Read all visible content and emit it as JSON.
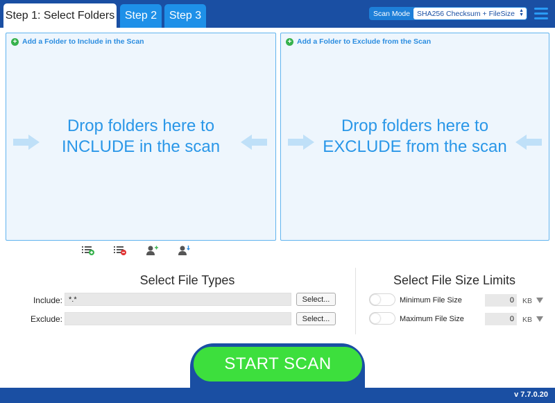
{
  "tabs": [
    {
      "label": "Step 1: Select Folders",
      "active": true
    },
    {
      "label": "Step 2",
      "active": false
    },
    {
      "label": "Step 3",
      "active": false
    }
  ],
  "scan_mode": {
    "label": "Scan Mode",
    "selected": "SHA256 Checksum + FileSize"
  },
  "include_panel": {
    "header": "Add a Folder to Include in the Scan",
    "drop_text": "Drop folders here to INCLUDE in the scan"
  },
  "exclude_panel": {
    "header": "Add a Folder to Exclude from the Scan",
    "drop_text": "Drop folders here to EXCLUDE from the scan"
  },
  "file_types": {
    "title": "Select File Types",
    "include_label": "Include:",
    "include_value": "*.*",
    "exclude_label": "Exclude:",
    "exclude_value": "",
    "select_label": "Select..."
  },
  "size_limits": {
    "title": "Select File Size Limits",
    "min_label": "Minimum File Size",
    "min_value": "0",
    "max_label": "Maximum File Size",
    "max_value": "0",
    "unit": "KB"
  },
  "start_label": "START SCAN",
  "version": "v 7.7.0.20",
  "colors": {
    "header_bg": "#1a4fa3",
    "tab_inactive": "#1e90e8",
    "accent_text": "#2a97e8",
    "start_green": "#3ddf3d"
  }
}
